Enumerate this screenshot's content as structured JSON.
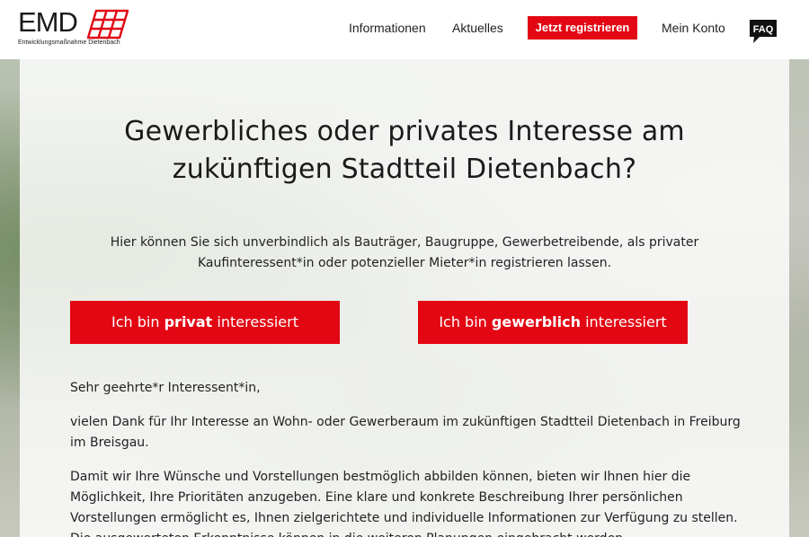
{
  "logo": {
    "title": "EMD",
    "subtitle": "Entwicklungsmaßnahme Dietenbach",
    "accent": "#e30613"
  },
  "nav": {
    "items": [
      {
        "label": "Informationen"
      },
      {
        "label": "Aktuelles"
      },
      {
        "label": "Jetzt registrieren"
      },
      {
        "label": "Mein Konto"
      }
    ],
    "faq_label": "FAQ"
  },
  "main": {
    "headline_line1": "Gewerbliches oder privates Interesse am",
    "headline_line2": "zukünftigen Stadtteil Dietenbach?",
    "intro_line1": "Hier können Sie sich unverbindlich als Bauträger, Baugruppe, Gewerbetreibende, als privater",
    "intro_line2": "Kaufinteressent*in oder potenzieller Mieter*in registrieren lassen.",
    "cta_privat": {
      "prefix": "Ich bin ",
      "bold": "privat",
      "suffix": " interessiert"
    },
    "cta_gewerb": {
      "prefix": "Ich bin ",
      "bold": "gewerblich",
      "suffix": " interessiert"
    },
    "salutation": "Sehr geehrte*r Interessent*in,",
    "para1": "vielen Dank für Ihr Interesse an Wohn- oder Gewerberaum im zukünftigen Stadtteil Dietenbach in Freiburg im Breisgau.",
    "para2": "Damit wir Ihre Wünsche und Vorstellungen bestmöglich abbilden können, bieten wir Ihnen hier die Möglichkeit, Ihre Prioritäten anzugeben. Eine klare und konkrete Beschreibung Ihrer persönlichen Vorstellungen ermöglicht es, Ihnen zielgerichtete und individuelle Informationen zur Verfügung zu stellen. Die ausgewerteten Erkenntnisse können in die weiteren Planungen eingebracht werden."
  },
  "colors": {
    "brand_red": "#e30613",
    "text": "#222222"
  }
}
